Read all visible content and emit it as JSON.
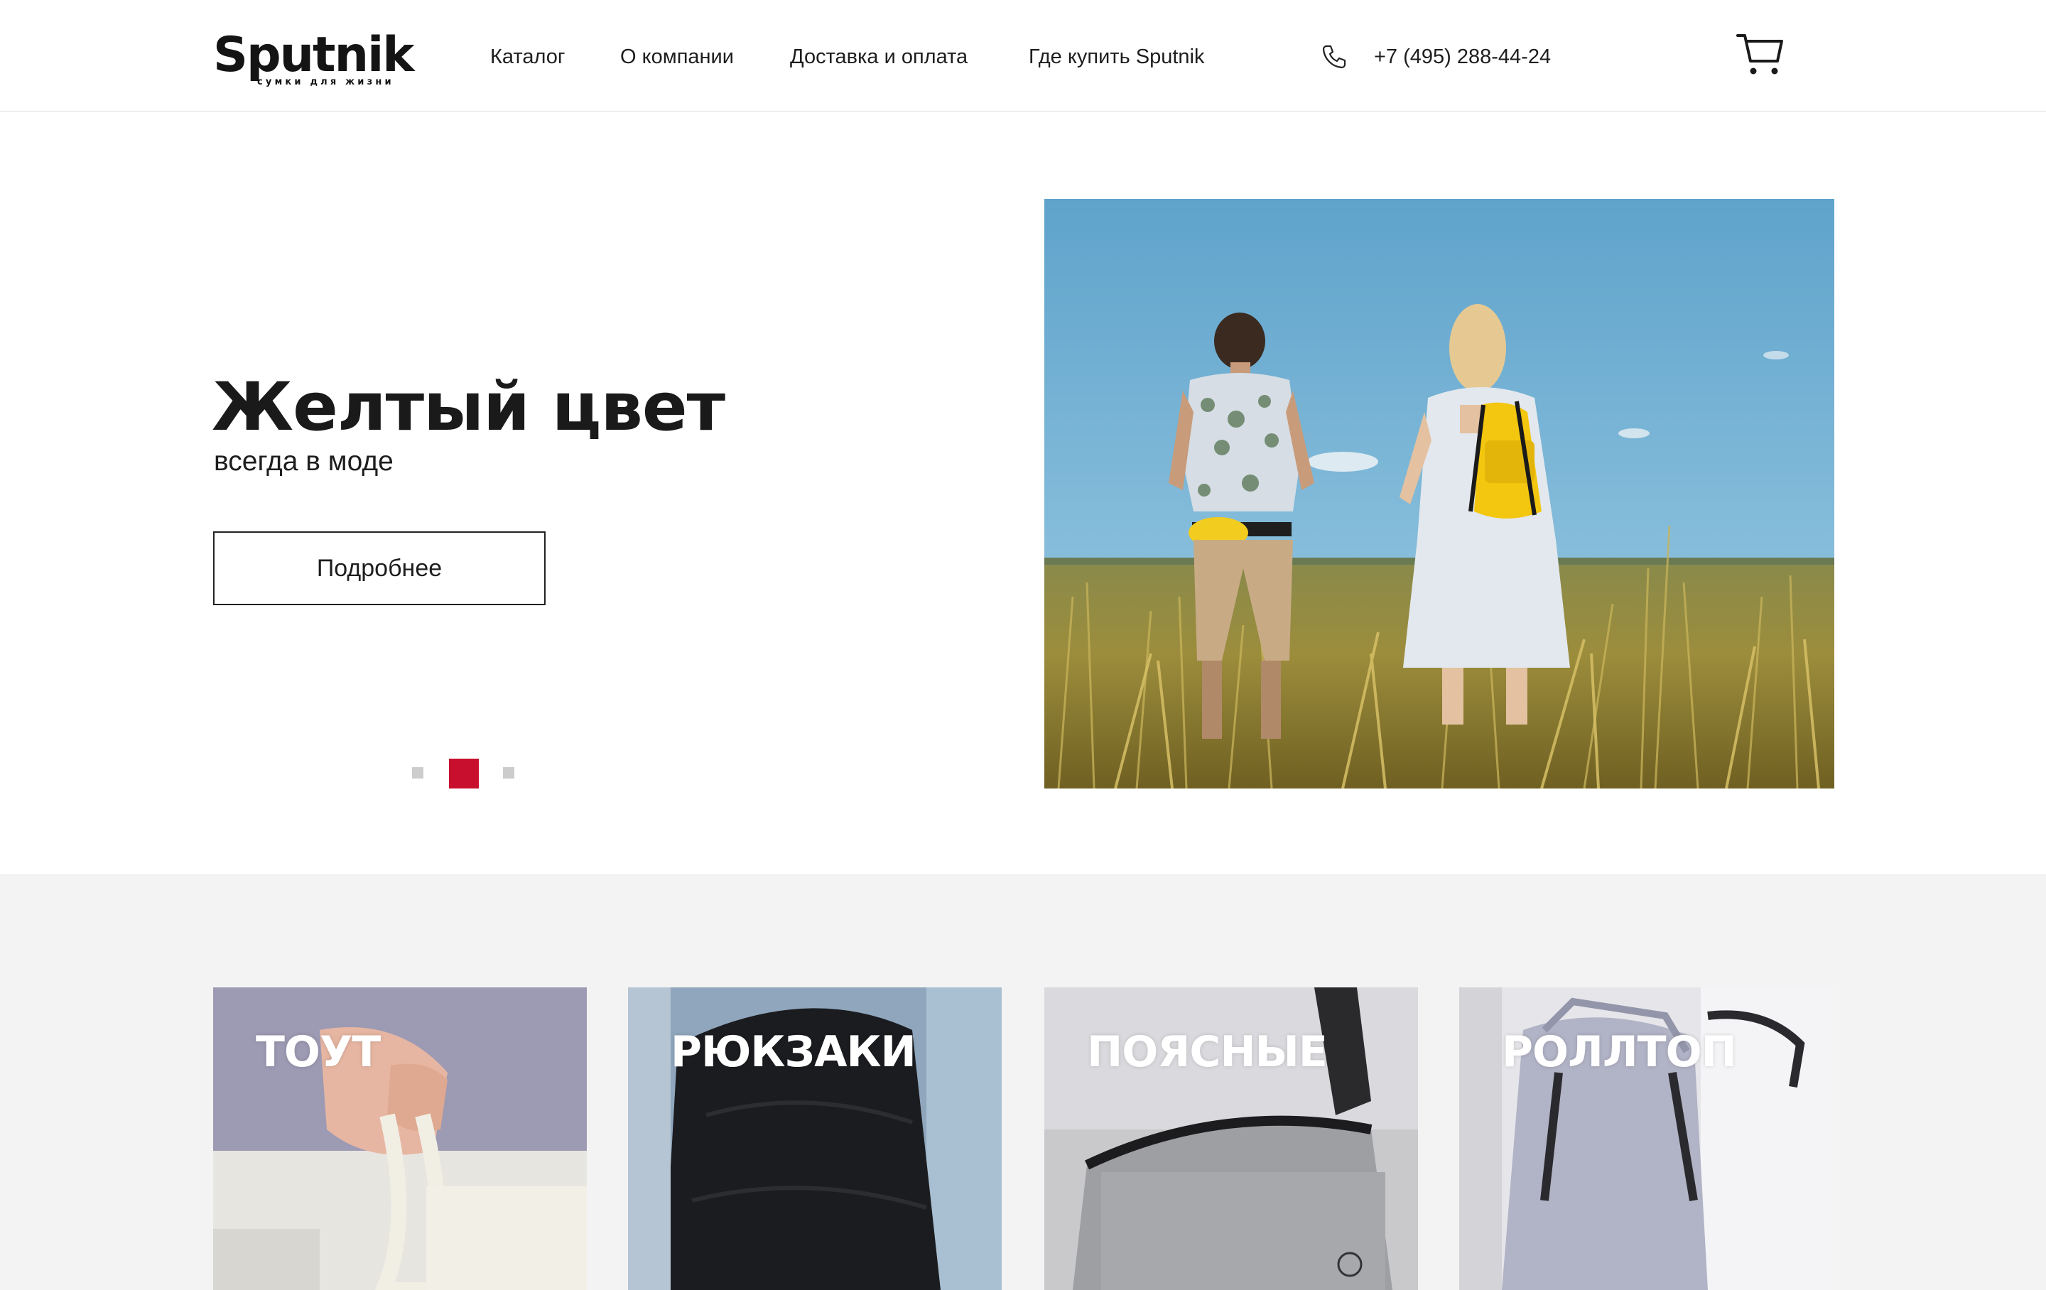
{
  "header": {
    "logo": {
      "name": "Sputnik",
      "tagline": "сумки для жизни"
    },
    "nav": [
      "Каталог",
      "О компании",
      "Доставка и оплата",
      "Где купить Sputnik"
    ],
    "phone": "+7 (495) 288-44-24",
    "icons": {
      "phone": "phone-icon",
      "cart": "cart-icon"
    }
  },
  "hero": {
    "title": "Желтый цвет",
    "subtitle": "всегда в моде",
    "button": "Подробнее",
    "slider": {
      "total": 3,
      "active": 2
    },
    "photo": "couple-in-wheat-field-with-yellow-backpack"
  },
  "categories": [
    {
      "label": "ТОУТ"
    },
    {
      "label": "РЮКЗАКИ"
    },
    {
      "label": "ПОЯСНЫЕ"
    },
    {
      "label": "РОЛЛТОП"
    }
  ],
  "colors": {
    "accent": "#c8102e",
    "text": "#1e1e1e",
    "section_bg": "#f3f3f3"
  }
}
